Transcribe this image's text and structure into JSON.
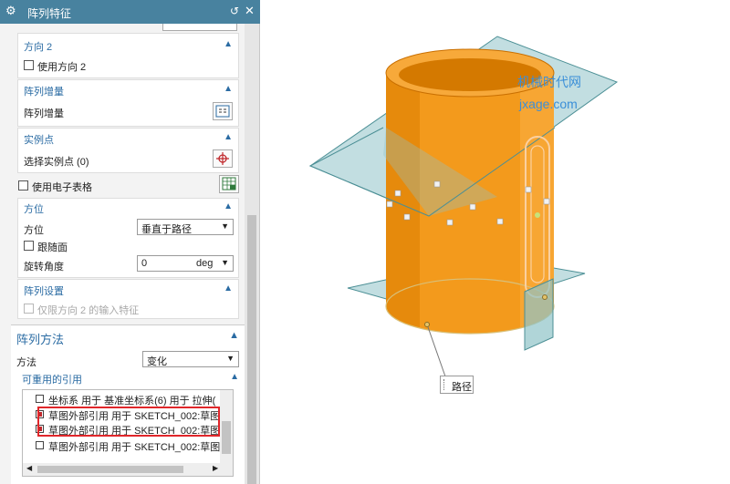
{
  "dialog": {
    "title": "阵列特征",
    "icons": {
      "title": "gear-icon",
      "reset": "reset-icon",
      "close": "close-icon"
    }
  },
  "direction2": {
    "header": "方向 2",
    "use_label": "使用方向 2",
    "checked": false
  },
  "increment": {
    "header": "阵列增量",
    "label": "阵列增量"
  },
  "instance": {
    "header": "实例点",
    "label": "选择实例点 (0)"
  },
  "spreadsheet": {
    "label": "使用电子表格",
    "checked": false
  },
  "orientation": {
    "header": "方位",
    "label": "方位",
    "value": "垂直于路径",
    "follow_label": "跟随面",
    "follow_checked": false,
    "rotation_label": "旋转角度",
    "rotation_value": "0",
    "rotation_unit": "deg"
  },
  "settings": {
    "header": "阵列设置",
    "limit_label": "仅限方向 2 的输入特征"
  },
  "method": {
    "header": "阵列方法",
    "label": "方法",
    "value": "变化",
    "reusable_header": "可重用的引用",
    "items": [
      {
        "text": "坐标系 用于 基准坐标系(6) 用于 拉伸(",
        "checked": false
      },
      {
        "text": "草图外部引用 用于 SKETCH_002:草图",
        "checked": true
      },
      {
        "text": "草图外部引用 用于 SKETCH_002:草图",
        "checked": true
      },
      {
        "text": "草图外部引用 用于 SKETCH_002:草图",
        "checked": false
      }
    ]
  },
  "viewport": {
    "watermark_line1": "机械时代网",
    "watermark_line2": "jxage.com",
    "callout_label": "路径",
    "colors": {
      "body": "#f39a1c",
      "plane": "#8fc3c8",
      "accent": "#48829f"
    }
  }
}
